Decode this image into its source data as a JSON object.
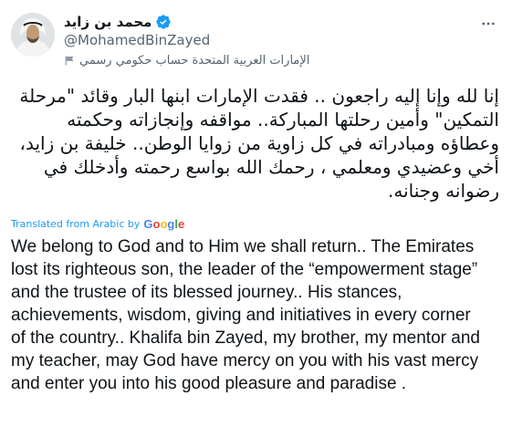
{
  "author": {
    "display_name": "محمد بن زايد",
    "handle": "@MohamedBinZayed",
    "affiliation": "الإمارات العربية المتحدة حساب حكومي رسمي"
  },
  "icons": {
    "verified": "verified-badge-icon",
    "flag": "government-flag-icon",
    "more": "more-options-icon"
  },
  "colors": {
    "accent": "#1d9bf0",
    "muted": "#536471",
    "text": "#0f1419"
  },
  "tweet": {
    "original_text": "إنا لله وإنا إليه راجعون .. فقدت الإمارات ابنها البار وقائد \"مرحلة التمكين\" وأمين رحلتها المباركة.. مواقفه وإنجازاته وحكمته وعطاؤه ومبادراته في كل زاوية من زوايا الوطن.. خليفة بن زايد، أخي وعضيدي ومعلمي ، رحمك الله بواسع رحمته وأدخلك في رضوانه وجنانه.",
    "translated_by": "Translated from Arabic by",
    "google": [
      "G",
      "o",
      "o",
      "g",
      "l",
      "e"
    ],
    "translation": "We belong to God and to Him we shall return.. The Emirates lost its righteous son, the leader of the “empowerment stage” and the trustee of its blessed journey.. His stances, achievements, wisdom, giving and initiatives in every corner of the country.. Khalifa bin Zayed, my brother, my mentor and my teacher, may God have mercy on you with his vast mercy and enter you into his good pleasure and paradise ."
  }
}
